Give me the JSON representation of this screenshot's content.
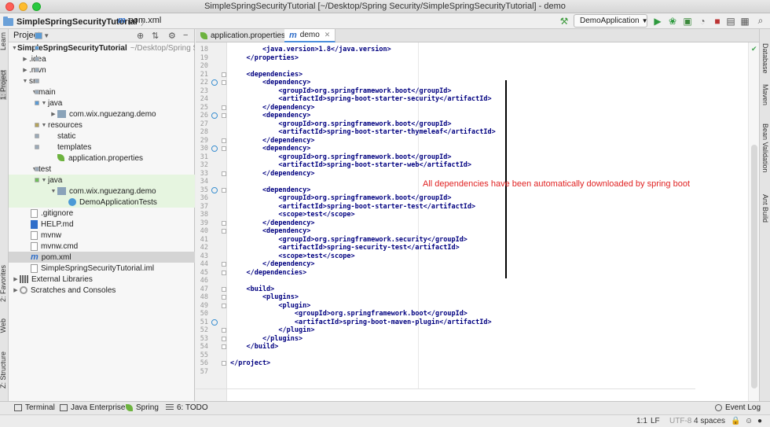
{
  "window": {
    "title": "SimpleSpringSecurityTutorial [~/Desktop/Spring Security/SimpleSpringSecurityTutorial] - demo"
  },
  "navbar": {
    "breadcrumb_project": "SimpleSpringSecurityTutorial",
    "breadcrumb_file": "pom.xml",
    "run_config": "DemoApplication"
  },
  "left_strip": {
    "learn": "Learn",
    "project": "1: Project",
    "favorites": "2: Favorites",
    "web": "Web",
    "structure": "Z: Structure"
  },
  "right_strip": {
    "database": "Database",
    "maven": "Maven",
    "bean_validation": "Bean Validation",
    "ant_build": "Ant Build"
  },
  "project_panel": {
    "header": "Project",
    "tree": [
      {
        "label": "SimpleSpringSecurityTutorial",
        "hint": "~/Desktop/Spring Security/SimpleSpringSecurityTutorial",
        "bold": true
      },
      {
        "label": ".idea"
      },
      {
        "label": ".mvn"
      },
      {
        "label": "src"
      },
      {
        "label": "main"
      },
      {
        "label": "java"
      },
      {
        "label": "com.wix.nguezang.demo"
      },
      {
        "label": "resources"
      },
      {
        "label": "static"
      },
      {
        "label": "templates"
      },
      {
        "label": "application.properties"
      },
      {
        "label": "test"
      },
      {
        "label": "java"
      },
      {
        "label": "com.wix.nguezang.demo"
      },
      {
        "label": "DemoApplicationTests"
      },
      {
        "label": ".gitignore"
      },
      {
        "label": "HELP.md"
      },
      {
        "label": "mvnw"
      },
      {
        "label": "mvnw.cmd"
      },
      {
        "label": "pom.xml"
      },
      {
        "label": "SimpleSpringSecurityTutorial.iml"
      },
      {
        "label": "External Libraries"
      },
      {
        "label": "Scratches and Consoles"
      }
    ]
  },
  "editor": {
    "tabs": [
      {
        "label": "application.properties"
      },
      {
        "label": "demo"
      }
    ],
    "lines": [
      {
        "n": "18",
        "text": "        <java.version>1.8</java.version>"
      },
      {
        "n": "19",
        "text": "    </properties>"
      },
      {
        "n": "20",
        "text": ""
      },
      {
        "n": "21",
        "text": "    <dependencies>"
      },
      {
        "n": "22",
        "text": "        <dependency>"
      },
      {
        "n": "23",
        "text": "            <groupId>org.springframework.boot</groupId>"
      },
      {
        "n": "24",
        "text": "            <artifactId>spring-boot-starter-security</artifactId>"
      },
      {
        "n": "25",
        "text": "        </dependency>"
      },
      {
        "n": "26",
        "text": "        <dependency>"
      },
      {
        "n": "27",
        "text": "            <groupId>org.springframework.boot</groupId>"
      },
      {
        "n": "28",
        "text": "            <artifactId>spring-boot-starter-thymeleaf</artifactId>"
      },
      {
        "n": "29",
        "text": "        </dependency>"
      },
      {
        "n": "30",
        "text": "        <dependency>"
      },
      {
        "n": "31",
        "text": "            <groupId>org.springframework.boot</groupId>"
      },
      {
        "n": "32",
        "text": "            <artifactId>spring-boot-starter-web</artifactId>"
      },
      {
        "n": "33",
        "text": "        </dependency>"
      },
      {
        "n": "34",
        "text": ""
      },
      {
        "n": "35",
        "text": "        <dependency>"
      },
      {
        "n": "36",
        "text": "            <groupId>org.springframework.boot</groupId>"
      },
      {
        "n": "37",
        "text": "            <artifactId>spring-boot-starter-test</artifactId>"
      },
      {
        "n": "38",
        "text": "            <scope>test</scope>"
      },
      {
        "n": "39",
        "text": "        </dependency>"
      },
      {
        "n": "40",
        "text": "        <dependency>"
      },
      {
        "n": "41",
        "text": "            <groupId>org.springframework.security</groupId>"
      },
      {
        "n": "42",
        "text": "            <artifactId>spring-security-test</artifactId>"
      },
      {
        "n": "43",
        "text": "            <scope>test</scope>"
      },
      {
        "n": "44",
        "text": "        </dependency>"
      },
      {
        "n": "45",
        "text": "    </dependencies>"
      },
      {
        "n": "46",
        "text": ""
      },
      {
        "n": "47",
        "text": "    <build>"
      },
      {
        "n": "48",
        "text": "        <plugins>"
      },
      {
        "n": "49",
        "text": "            <plugin>"
      },
      {
        "n": "50",
        "text": "                <groupId>org.springframework.boot</groupId>"
      },
      {
        "n": "51",
        "text": "                <artifactId>spring-boot-maven-plugin</artifactId>"
      },
      {
        "n": "52",
        "text": "            </plugin>"
      },
      {
        "n": "53",
        "text": "        </plugins>"
      },
      {
        "n": "54",
        "text": "    </build>"
      },
      {
        "n": "55",
        "text": ""
      },
      {
        "n": "56",
        "text": "</project>"
      },
      {
        "n": "57",
        "text": ""
      }
    ],
    "annotation": "All dependencies have been automatically downloaded by spring boot"
  },
  "bottom_tools": [
    "Terminal",
    "Java Enterprise",
    "Spring",
    "6: TODO",
    "Event Log"
  ],
  "status": {
    "position": "1:1",
    "line_sep": "LF",
    "encoding": "UTF-8",
    "indent": "4 spaces"
  }
}
